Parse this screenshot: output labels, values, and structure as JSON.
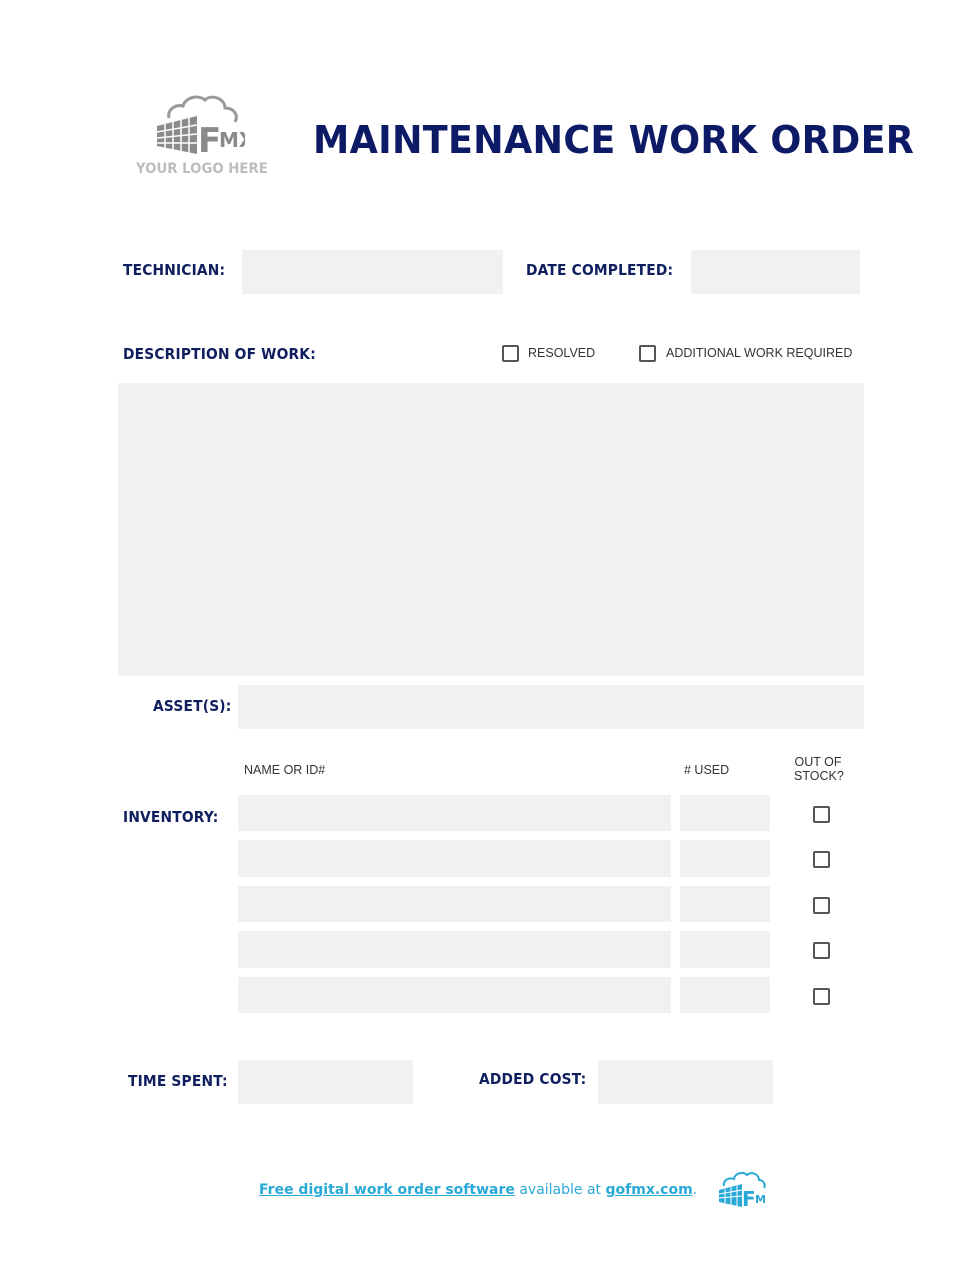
{
  "logo": {
    "icon": "fmx-building-cloud-logo",
    "brand_text": "FMX",
    "placeholder_text": "YOUR LOGO HERE"
  },
  "header": {
    "title": "MAINTENANCE WORK ORDER"
  },
  "fields": {
    "technician": {
      "label": "TECHNICIAN:",
      "value": ""
    },
    "date_completed": {
      "label": "DATE COMPLETED:",
      "value": ""
    },
    "description": {
      "label": "DESCRIPTION OF WORK:",
      "value": ""
    },
    "assets": {
      "label": "ASSET(S):",
      "value": ""
    },
    "time_spent": {
      "label": "TIME SPENT:",
      "value": ""
    },
    "added_cost": {
      "label": "ADDED COST:",
      "value": ""
    }
  },
  "status_options": [
    {
      "label": "RESOLVED",
      "checked": false
    },
    {
      "label": "ADDITIONAL WORK REQUIRED",
      "checked": false
    }
  ],
  "inventory": {
    "label": "INVENTORY:",
    "columns": {
      "name": "NAME OR ID#",
      "used": "# USED",
      "out_of_stock_line1": "OUT OF",
      "out_of_stock_line2": "STOCK?"
    },
    "rows": [
      {
        "name": "",
        "used": "",
        "out_of_stock": false
      },
      {
        "name": "",
        "used": "",
        "out_of_stock": false
      },
      {
        "name": "",
        "used": "",
        "out_of_stock": false
      },
      {
        "name": "",
        "used": "",
        "out_of_stock": false
      },
      {
        "name": "",
        "used": "",
        "out_of_stock": false
      }
    ]
  },
  "footer": {
    "link_text": "Free digital work order software",
    "middle_text": " available at ",
    "site_link": "gofmx.com",
    "end_text": ".",
    "icon": "fmx-logo-small"
  },
  "colors": {
    "navy": "#0d1a66",
    "field_gray": "#f1f1f1",
    "footer_blue": "#29a9d6",
    "logo_gray": "#8a8a8a"
  }
}
